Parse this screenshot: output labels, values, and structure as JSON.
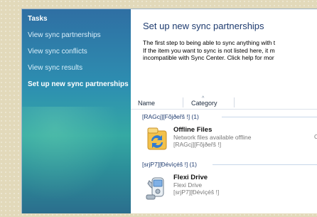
{
  "sidebar": {
    "tasks_heading": "Tasks",
    "items": [
      {
        "label": "View sync partnerships"
      },
      {
        "label": "View sync conflicts"
      },
      {
        "label": "View sync results"
      },
      {
        "label": "Set up new sync partnerships"
      }
    ]
  },
  "main": {
    "title": "Set up new sync partnerships",
    "description_lines": [
      "The first step to being able to sync anything with t",
      "If the item you want to sync is not listed here, it m",
      "incompatible with Sync Center. Click help for mor"
    ]
  },
  "columns": {
    "name": "Name",
    "category": "Category"
  },
  "groups": [
    {
      "header": "[RAGcj][Fõjðeřš !] (1)",
      "items": [
        {
          "name": "Offline Files",
          "line2": "Network files available offline",
          "line3": "[RAGcj][Fõjðeřš !]",
          "status": "Of",
          "icon": "offline-files-icon"
        }
      ]
    },
    {
      "header": "[srjP7][Ðévìçéš !] (1)",
      "items": [
        {
          "name": "Flexi Drive",
          "line2": "Flexi Drive",
          "line3": "[srjP7][Ðévìçéš !]",
          "status": "",
          "icon": "phone-device-icon"
        }
      ]
    }
  ],
  "colors": {
    "sidebar_top": "#2f6fa3",
    "sidebar_bottom": "#2b6e8d",
    "title": "#1e3b6f"
  }
}
